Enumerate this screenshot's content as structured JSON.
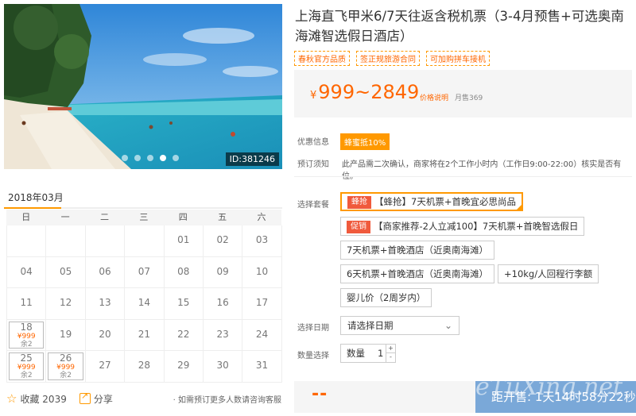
{
  "hero": {
    "image_id": "ID:381246",
    "slide_count": 5,
    "active_slide": 4
  },
  "calendar": {
    "month_title": "2018年03月",
    "weekdays": [
      "日",
      "一",
      "二",
      "三",
      "四",
      "五",
      "六"
    ],
    "weeks": [
      [
        null,
        null,
        null,
        null,
        "01",
        "02",
        "03"
      ],
      [
        "04",
        "05",
        "06",
        "07",
        "08",
        "09",
        "10"
      ],
      [
        "11",
        "12",
        "13",
        "14",
        "15",
        "16",
        "17"
      ],
      [
        "18",
        "19",
        "20",
        "21",
        "22",
        "23",
        "24"
      ],
      [
        "25",
        "26",
        "27",
        "28",
        "29",
        "30",
        "31"
      ]
    ],
    "available": {
      "18": {
        "price": "¥999",
        "remain": "余2"
      },
      "25": {
        "price": "¥999",
        "remain": "余2"
      },
      "26": {
        "price": "¥999",
        "remain": "余2"
      }
    }
  },
  "actions": {
    "favorite_label": "收藏",
    "favorite_count": "2039",
    "share_label": "分享",
    "booking_note": "· 如需预订更多人数请咨询客服"
  },
  "product": {
    "title": "上海直飞甲米6/7天往返含税机票（3-4月预售+可选奥南海滩智选假日酒店）",
    "tags": [
      "春秋官方品质",
      "签正规旅游合同",
      "可加购拼车接机"
    ],
    "price_currency": "¥",
    "price_range": "999~2849",
    "price_note_link": "价格说明",
    "monthly_sales": "月售369"
  },
  "offers": {
    "discount_label": "优惠信息",
    "discount_badge": "蜂蜜抵10%",
    "notice_label": "预订须知",
    "notice_text": "此产品需二次确认，商家将在2个工作小时内（工作日9:00-22:00）核实是否有位。"
  },
  "packages": {
    "label": "选择套餐",
    "options": [
      {
        "flag": "蜂抢",
        "text": "【蜂抢】7天机票+首晚宜必思尚品",
        "selected": true
      },
      {
        "flag": "促销",
        "text": "【商家推荐-2人立减100】7天机票+首晚智选假日"
      },
      {
        "text": "7天机票+首晚酒店（近奥南海滩）"
      },
      {
        "text": "6天机票+首晚酒店（近奥南海滩）"
      },
      {
        "text": "+10kg/人回程行李额"
      },
      {
        "text": "婴儿价（2周岁内）"
      }
    ]
  },
  "date_select": {
    "label": "选择日期",
    "placeholder": "请选择日期"
  },
  "quantity": {
    "label": "数量选择",
    "field_label": "数量",
    "value": "1"
  },
  "purchase": {
    "price_placeholder": "--",
    "countdown": "距开售: 1天14时58分22秒"
  },
  "watermark": "eTuXing.net",
  "colors": {
    "accent": "#ff9900",
    "price": "#ff6600",
    "countdown_bg": "#7aa8d8",
    "flag_red": "#f05a3c"
  }
}
